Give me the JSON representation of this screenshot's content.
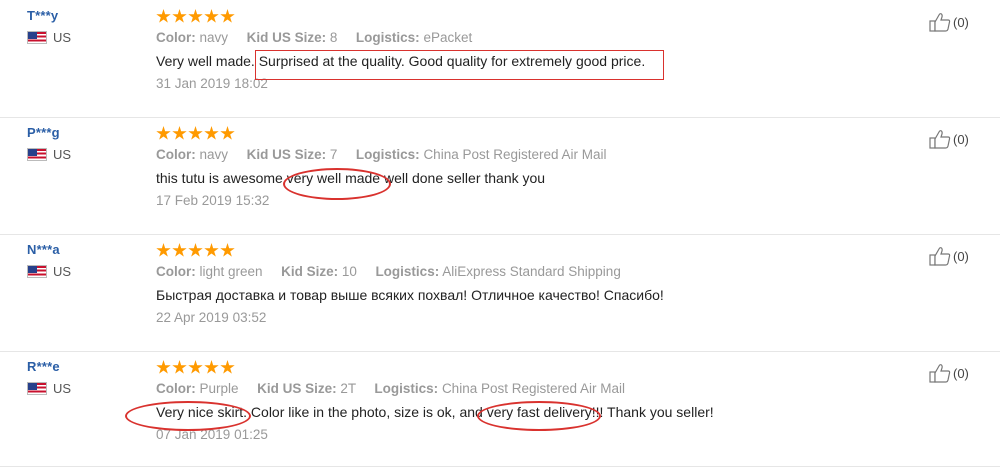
{
  "reviews": [
    {
      "user": "T***y",
      "country": "US",
      "attrs": [
        {
          "key": "Color:",
          "value": "navy"
        },
        {
          "key": "Kid US Size:",
          "value": "8"
        },
        {
          "key": "Logistics:",
          "value": "ePacket"
        }
      ],
      "text": "Very well made. Surprised at the quality. Good quality for extremely good price.",
      "time": "31 Jan 2019 18:02",
      "helpful": "(0)",
      "rating_stars": 5
    },
    {
      "user": "P***g",
      "country": "US",
      "attrs": [
        {
          "key": "Color:",
          "value": "navy"
        },
        {
          "key": "Kid US Size:",
          "value": "7"
        },
        {
          "key": "Logistics:",
          "value": "China Post Registered Air Mail"
        }
      ],
      "text": "this tutu is awesome very well made well done seller thank you",
      "time": "17 Feb 2019 15:32",
      "helpful": "(0)",
      "rating_stars": 5
    },
    {
      "user": "N***a",
      "country": "US",
      "attrs": [
        {
          "key": "Color:",
          "value": "light green"
        },
        {
          "key": "Kid Size:",
          "value": "10"
        },
        {
          "key": "Logistics:",
          "value": "AliExpress Standard Shipping"
        }
      ],
      "text": "Быстрая доставка и товар выше всяких похвал! Отличное качество! Спасибо!",
      "time": "22 Apr 2019 03:52",
      "helpful": "(0)",
      "rating_stars": 5
    },
    {
      "user": "R***e",
      "country": "US",
      "attrs": [
        {
          "key": "Color:",
          "value": "Purple"
        },
        {
          "key": "Kid US Size:",
          "value": "2T"
        },
        {
          "key": "Logistics:",
          "value": "China Post Registered Air Mail"
        }
      ],
      "text": "Very nice skirt. Color like in the photo, size is ok, and very fast delivery!!! Thank you seller!",
      "time": "07 Jan 2019 01:25",
      "helpful": "(0)",
      "rating_stars": 5
    }
  ],
  "icons": {
    "rating": "star-icon",
    "country": "us-flag-icon",
    "helpful": "thumbs-up-icon"
  },
  "colors": {
    "star": "#ff9a00",
    "username": "#2a5ea6",
    "annotation": "#d9322e"
  }
}
